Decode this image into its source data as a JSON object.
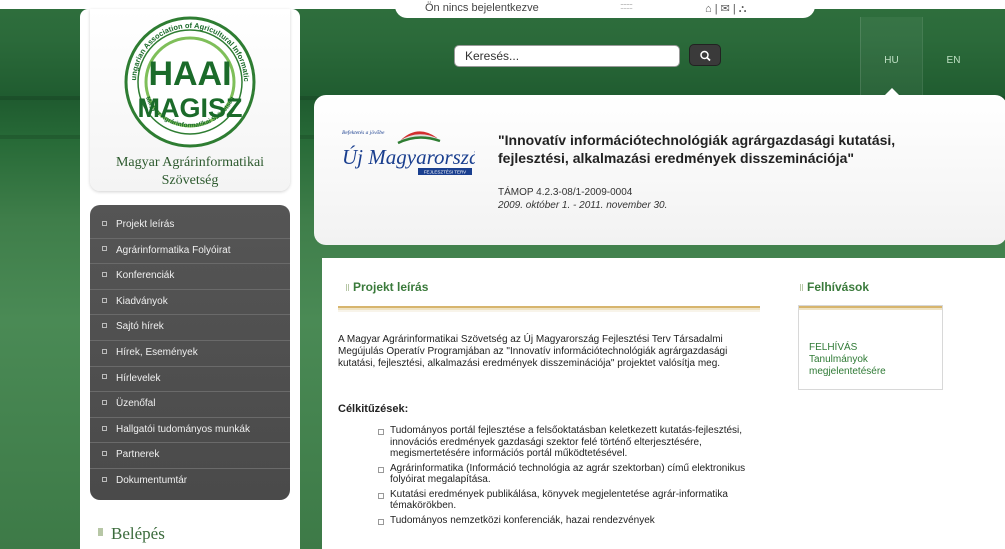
{
  "status": {
    "login_status": "Ön nincs bejelentkezve",
    "dots": "::::::::",
    "icons": "⌂ | ✉ | ⛬"
  },
  "search": {
    "placeholder": "Keresés..."
  },
  "languages": [
    "HU",
    "EN"
  ],
  "logo": {
    "org_name_line1": "Magyar Agrárinformatikai",
    "org_name_line2": "Szövetség",
    "emblem_text_top": "Hungarian Association of Agricultural Informatics",
    "emblem_text_bottom": "Magyar Agrárinformatikai Szövetség",
    "emblem_haai": "HAAI",
    "emblem_magisz": "MAGISZ"
  },
  "menu": [
    "Projekt leírás",
    "Agrárinformatika Folyóirat",
    "Konferenciák",
    "Kiadványok",
    "Sajtó hírek",
    "Hírek, Események",
    "Hírlevelek",
    "Üzenőfal",
    "Hallgatói tudományos munkák",
    "Partnerek",
    "Dokumentumtár"
  ],
  "login": {
    "title": "Belépés"
  },
  "banner": {
    "logo_small": "Befektetés a jövőbe",
    "logo_main": "Új Magyarország",
    "logo_sub": "FEJLESZTÉSI TERV",
    "title": "\"Innovatív információtechnológiák agrárgazdasági kutatási, fejlesztési, alkalmazási eredmények disszeminációja\"",
    "code": "TÁMOP 4.2.3-08/1-2009-0004",
    "date": "2009. október 1. - 2011. november 30."
  },
  "main": {
    "section_title": "Projekt leírás",
    "intro": "A Magyar Agrárinformatikai Szövetség az Új Magyarország Fejlesztési Terv Társadalmi Megújulás Operatív Programjában az \"Innovatív információtechnológiák agrárgazdasági kutatási, fejlesztési, alkalmazási eredmények disszeminációja\" projektet valósítja meg.",
    "goals_title": "Célkitűzések:",
    "goals": [
      "Tudományos portál fejlesztése a felsőoktatásban keletkezett kutatás-fejlesztési, innovációs eredmények gazdasági szektor felé történő elterjesztésére, megismertetésére információs portál működtetésével.",
      "Agrárinformatika (Információ technológia az agrár szektorban) című elektronikus folyóirat megalapítása.",
      "Kutatási eredmények publikálása, könyvek megjelentetése agrár-informatika témakörökben.",
      "Tudományos nemzetközi konferenciák, hazai rendezvények"
    ]
  },
  "calls": {
    "section_title": "Felhívások",
    "line1": "FELHÍVÁS",
    "line2": "Tanulmányok megjelentetésére"
  }
}
